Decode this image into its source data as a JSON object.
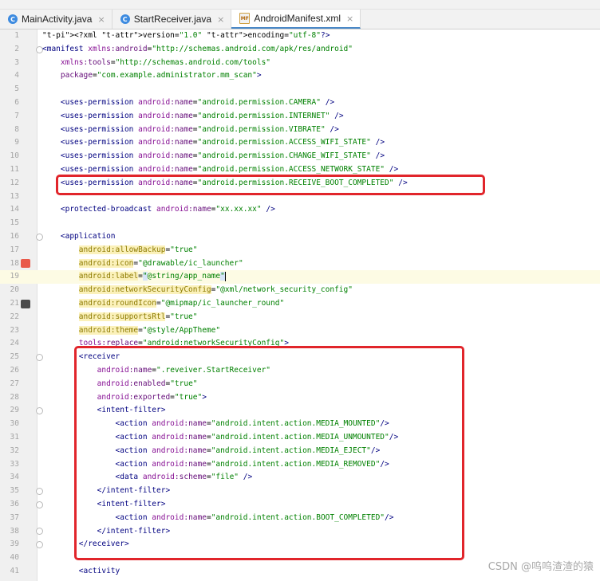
{
  "tabs": [
    {
      "label": "MainActivity.java",
      "icon": "java-class-icon",
      "active": false
    },
    {
      "label": "StartReceiver.java",
      "icon": "java-class-icon",
      "active": false
    },
    {
      "label": "AndroidManifest.xml",
      "icon": "xml-file-icon",
      "active": true
    }
  ],
  "editor": {
    "lines": [
      {
        "num": "1",
        "code": "<?xml version=\"1.0\" encoding=\"utf-8\"?>"
      },
      {
        "num": "2",
        "code": "<manifest xmlns:android=\"http://schemas.android.com/apk/res/android\""
      },
      {
        "num": "3",
        "code": "    xmlns:tools=\"http://schemas.android.com/tools\""
      },
      {
        "num": "4",
        "code": "    package=\"com.example.administrator.mm_scan\">"
      },
      {
        "num": "5",
        "code": ""
      },
      {
        "num": "6",
        "code": "    <uses-permission android:name=\"android.permission.CAMERA\" />"
      },
      {
        "num": "7",
        "code": "    <uses-permission android:name=\"android.permission.INTERNET\" />"
      },
      {
        "num": "8",
        "code": "    <uses-permission android:name=\"android.permission.VIBRATE\" />"
      },
      {
        "num": "9",
        "code": "    <uses-permission android:name=\"android.permission.ACCESS_WIFI_STATE\" />"
      },
      {
        "num": "10",
        "code": "    <uses-permission android:name=\"android.permission.CHANGE_WIFI_STATE\" />"
      },
      {
        "num": "11",
        "code": "    <uses-permission android:name=\"android.permission.ACCESS_NETWORK_STATE\" />"
      },
      {
        "num": "12",
        "code": "    <uses-permission android:name=\"android.permission.RECEIVE_BOOT_COMPLETED\" />"
      },
      {
        "num": "13",
        "code": ""
      },
      {
        "num": "14",
        "code": "    <protected-broadcast android:name=\"xx.xx.xx\" />"
      },
      {
        "num": "15",
        "code": ""
      },
      {
        "num": "16",
        "code": "    <application"
      },
      {
        "num": "17",
        "code": "        android:allowBackup=\"true\""
      },
      {
        "num": "18",
        "code": "        android:icon=\"@drawable/ic_launcher\""
      },
      {
        "num": "19",
        "code": "        android:label=\"@string/app_name\""
      },
      {
        "num": "20",
        "code": "        android:networkSecurityConfig=\"@xml/network_security_config\""
      },
      {
        "num": "21",
        "code": "        android:roundIcon=\"@mipmap/ic_launcher_round\""
      },
      {
        "num": "22",
        "code": "        android:supportsRtl=\"true\""
      },
      {
        "num": "23",
        "code": "        android:theme=\"@style/AppTheme\""
      },
      {
        "num": "24",
        "code": "        tools:replace=\"android:networkSecurityConfig\">"
      },
      {
        "num": "25",
        "code": "        <receiver"
      },
      {
        "num": "26",
        "code": "            android:name=\".reveiver.StartReceiver\""
      },
      {
        "num": "27",
        "code": "            android:enabled=\"true\""
      },
      {
        "num": "28",
        "code": "            android:exported=\"true\">"
      },
      {
        "num": "29",
        "code": "            <intent-filter>"
      },
      {
        "num": "30",
        "code": "                <action android:name=\"android.intent.action.MEDIA_MOUNTED\"/>"
      },
      {
        "num": "31",
        "code": "                <action android:name=\"android.intent.action.MEDIA_UNMOUNTED\"/>"
      },
      {
        "num": "32",
        "code": "                <action android:name=\"android.intent.action.MEDIA_EJECT\"/>"
      },
      {
        "num": "33",
        "code": "                <action android:name=\"android.intent.action.MEDIA_REMOVED\"/>"
      },
      {
        "num": "34",
        "code": "                <data android:scheme=\"file\" />"
      },
      {
        "num": "35",
        "code": "            </intent-filter>"
      },
      {
        "num": "36",
        "code": "            <intent-filter>"
      },
      {
        "num": "37",
        "code": "                <action android:name=\"android.intent.action.BOOT_COMPLETED\"/>"
      },
      {
        "num": "38",
        "code": "            </intent-filter>"
      },
      {
        "num": "39",
        "code": "        </receiver>"
      },
      {
        "num": "40",
        "code": ""
      },
      {
        "num": "41",
        "code": "        <activity"
      }
    ]
  },
  "watermark": "CSDN @呜呜渣渣的猿",
  "colors": {
    "tag": "#000080",
    "attribute": "#660e7a",
    "value": "#008000",
    "annotation_box": "#e1252b",
    "highlight_attr": "#fbf1ba"
  }
}
